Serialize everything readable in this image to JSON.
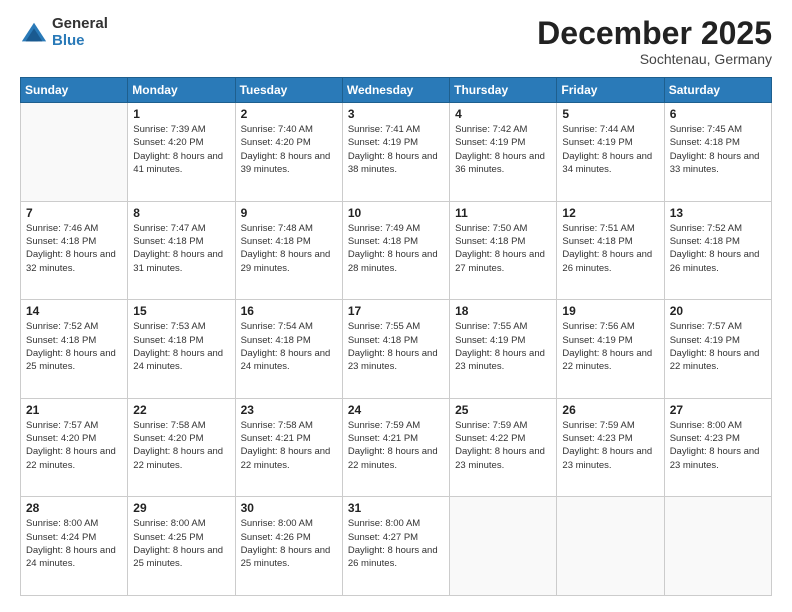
{
  "logo": {
    "general": "General",
    "blue": "Blue"
  },
  "header": {
    "month": "December 2025",
    "location": "Sochtenau, Germany"
  },
  "days_of_week": [
    "Sunday",
    "Monday",
    "Tuesday",
    "Wednesday",
    "Thursday",
    "Friday",
    "Saturday"
  ],
  "weeks": [
    [
      {
        "day": "",
        "sunrise": "",
        "sunset": "",
        "daylight": ""
      },
      {
        "day": "1",
        "sunrise": "Sunrise: 7:39 AM",
        "sunset": "Sunset: 4:20 PM",
        "daylight": "Daylight: 8 hours and 41 minutes."
      },
      {
        "day": "2",
        "sunrise": "Sunrise: 7:40 AM",
        "sunset": "Sunset: 4:20 PM",
        "daylight": "Daylight: 8 hours and 39 minutes."
      },
      {
        "day": "3",
        "sunrise": "Sunrise: 7:41 AM",
        "sunset": "Sunset: 4:19 PM",
        "daylight": "Daylight: 8 hours and 38 minutes."
      },
      {
        "day": "4",
        "sunrise": "Sunrise: 7:42 AM",
        "sunset": "Sunset: 4:19 PM",
        "daylight": "Daylight: 8 hours and 36 minutes."
      },
      {
        "day": "5",
        "sunrise": "Sunrise: 7:44 AM",
        "sunset": "Sunset: 4:19 PM",
        "daylight": "Daylight: 8 hours and 34 minutes."
      },
      {
        "day": "6",
        "sunrise": "Sunrise: 7:45 AM",
        "sunset": "Sunset: 4:18 PM",
        "daylight": "Daylight: 8 hours and 33 minutes."
      }
    ],
    [
      {
        "day": "7",
        "sunrise": "Sunrise: 7:46 AM",
        "sunset": "Sunset: 4:18 PM",
        "daylight": "Daylight: 8 hours and 32 minutes."
      },
      {
        "day": "8",
        "sunrise": "Sunrise: 7:47 AM",
        "sunset": "Sunset: 4:18 PM",
        "daylight": "Daylight: 8 hours and 31 minutes."
      },
      {
        "day": "9",
        "sunrise": "Sunrise: 7:48 AM",
        "sunset": "Sunset: 4:18 PM",
        "daylight": "Daylight: 8 hours and 29 minutes."
      },
      {
        "day": "10",
        "sunrise": "Sunrise: 7:49 AM",
        "sunset": "Sunset: 4:18 PM",
        "daylight": "Daylight: 8 hours and 28 minutes."
      },
      {
        "day": "11",
        "sunrise": "Sunrise: 7:50 AM",
        "sunset": "Sunset: 4:18 PM",
        "daylight": "Daylight: 8 hours and 27 minutes."
      },
      {
        "day": "12",
        "sunrise": "Sunrise: 7:51 AM",
        "sunset": "Sunset: 4:18 PM",
        "daylight": "Daylight: 8 hours and 26 minutes."
      },
      {
        "day": "13",
        "sunrise": "Sunrise: 7:52 AM",
        "sunset": "Sunset: 4:18 PM",
        "daylight": "Daylight: 8 hours and 26 minutes."
      }
    ],
    [
      {
        "day": "14",
        "sunrise": "Sunrise: 7:52 AM",
        "sunset": "Sunset: 4:18 PM",
        "daylight": "Daylight: 8 hours and 25 minutes."
      },
      {
        "day": "15",
        "sunrise": "Sunrise: 7:53 AM",
        "sunset": "Sunset: 4:18 PM",
        "daylight": "Daylight: 8 hours and 24 minutes."
      },
      {
        "day": "16",
        "sunrise": "Sunrise: 7:54 AM",
        "sunset": "Sunset: 4:18 PM",
        "daylight": "Daylight: 8 hours and 24 minutes."
      },
      {
        "day": "17",
        "sunrise": "Sunrise: 7:55 AM",
        "sunset": "Sunset: 4:18 PM",
        "daylight": "Daylight: 8 hours and 23 minutes."
      },
      {
        "day": "18",
        "sunrise": "Sunrise: 7:55 AM",
        "sunset": "Sunset: 4:19 PM",
        "daylight": "Daylight: 8 hours and 23 minutes."
      },
      {
        "day": "19",
        "sunrise": "Sunrise: 7:56 AM",
        "sunset": "Sunset: 4:19 PM",
        "daylight": "Daylight: 8 hours and 22 minutes."
      },
      {
        "day": "20",
        "sunrise": "Sunrise: 7:57 AM",
        "sunset": "Sunset: 4:19 PM",
        "daylight": "Daylight: 8 hours and 22 minutes."
      }
    ],
    [
      {
        "day": "21",
        "sunrise": "Sunrise: 7:57 AM",
        "sunset": "Sunset: 4:20 PM",
        "daylight": "Daylight: 8 hours and 22 minutes."
      },
      {
        "day": "22",
        "sunrise": "Sunrise: 7:58 AM",
        "sunset": "Sunset: 4:20 PM",
        "daylight": "Daylight: 8 hours and 22 minutes."
      },
      {
        "day": "23",
        "sunrise": "Sunrise: 7:58 AM",
        "sunset": "Sunset: 4:21 PM",
        "daylight": "Daylight: 8 hours and 22 minutes."
      },
      {
        "day": "24",
        "sunrise": "Sunrise: 7:59 AM",
        "sunset": "Sunset: 4:21 PM",
        "daylight": "Daylight: 8 hours and 22 minutes."
      },
      {
        "day": "25",
        "sunrise": "Sunrise: 7:59 AM",
        "sunset": "Sunset: 4:22 PM",
        "daylight": "Daylight: 8 hours and 23 minutes."
      },
      {
        "day": "26",
        "sunrise": "Sunrise: 7:59 AM",
        "sunset": "Sunset: 4:23 PM",
        "daylight": "Daylight: 8 hours and 23 minutes."
      },
      {
        "day": "27",
        "sunrise": "Sunrise: 8:00 AM",
        "sunset": "Sunset: 4:23 PM",
        "daylight": "Daylight: 8 hours and 23 minutes."
      }
    ],
    [
      {
        "day": "28",
        "sunrise": "Sunrise: 8:00 AM",
        "sunset": "Sunset: 4:24 PM",
        "daylight": "Daylight: 8 hours and 24 minutes."
      },
      {
        "day": "29",
        "sunrise": "Sunrise: 8:00 AM",
        "sunset": "Sunset: 4:25 PM",
        "daylight": "Daylight: 8 hours and 25 minutes."
      },
      {
        "day": "30",
        "sunrise": "Sunrise: 8:00 AM",
        "sunset": "Sunset: 4:26 PM",
        "daylight": "Daylight: 8 hours and 25 minutes."
      },
      {
        "day": "31",
        "sunrise": "Sunrise: 8:00 AM",
        "sunset": "Sunset: 4:27 PM",
        "daylight": "Daylight: 8 hours and 26 minutes."
      },
      {
        "day": "",
        "sunrise": "",
        "sunset": "",
        "daylight": ""
      },
      {
        "day": "",
        "sunrise": "",
        "sunset": "",
        "daylight": ""
      },
      {
        "day": "",
        "sunrise": "",
        "sunset": "",
        "daylight": ""
      }
    ]
  ]
}
